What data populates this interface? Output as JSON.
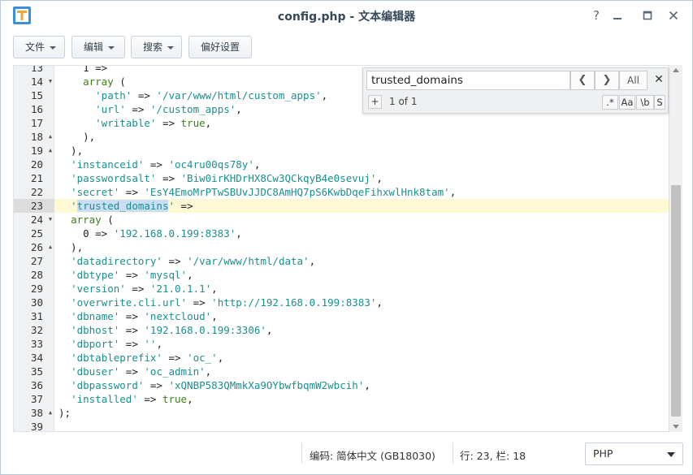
{
  "window": {
    "title": "config.php - 文本编辑器",
    "icons": {
      "help": "help-icon",
      "minimize": "minimize-icon",
      "maximize": "maximize-icon",
      "close": "close-icon"
    }
  },
  "toolbar": {
    "file": "文件",
    "edit": "编辑",
    "search": "搜索",
    "preferences": "偏好设置"
  },
  "search": {
    "query": "trusted_domains",
    "prev_glyph": "❮",
    "next_glyph": "❯",
    "all_label": "All",
    "close_glyph": "✕",
    "add_glyph": "+",
    "count": "1 of 1",
    "opt_regex": ".*",
    "opt_case": "Aa",
    "opt_word": "\\b",
    "opt_selection": "S"
  },
  "editor": {
    "active_line": 23,
    "lines": [
      {
        "n": "13",
        "fold": "",
        "code": "    1 =>"
      },
      {
        "n": "14",
        "fold": "▼",
        "code": "    array ("
      },
      {
        "n": "15",
        "fold": "",
        "code": "      'path' => '/var/www/html/custom_apps',"
      },
      {
        "n": "16",
        "fold": "",
        "code": "      'url' => '/custom_apps',"
      },
      {
        "n": "17",
        "fold": "",
        "code": "      'writable' => true,"
      },
      {
        "n": "18",
        "fold": "▲",
        "code": "    ),"
      },
      {
        "n": "19",
        "fold": "▲",
        "code": "  ),"
      },
      {
        "n": "20",
        "fold": "",
        "code": "  'instanceid' => 'oc4ru00qs78y',"
      },
      {
        "n": "21",
        "fold": "",
        "code": "  'passwordsalt' => 'Biw0irKHDrHX8Cw3QCkqyB4e0sevuj',"
      },
      {
        "n": "22",
        "fold": "",
        "code": "  'secret' => 'EsY4EmoMrPTwSBUvJJDC8AmHQ7pS6KwbDqeFihxwlHnk8tam',"
      },
      {
        "n": "23",
        "fold": "",
        "code": "  'trusted_domains' =>"
      },
      {
        "n": "24",
        "fold": "▼",
        "code": "  array ("
      },
      {
        "n": "25",
        "fold": "",
        "code": "    0 => '192.168.0.199:8383',"
      },
      {
        "n": "26",
        "fold": "▲",
        "code": "  ),"
      },
      {
        "n": "27",
        "fold": "",
        "code": "  'datadirectory' => '/var/www/html/data',"
      },
      {
        "n": "28",
        "fold": "",
        "code": "  'dbtype' => 'mysql',"
      },
      {
        "n": "29",
        "fold": "",
        "code": "  'version' => '21.0.1.1',"
      },
      {
        "n": "30",
        "fold": "",
        "code": "  'overwrite.cli.url' => 'http://192.168.0.199:8383',"
      },
      {
        "n": "31",
        "fold": "",
        "code": "  'dbname' => 'nextcloud',"
      },
      {
        "n": "32",
        "fold": "",
        "code": "  'dbhost' => '192.168.0.199:3306',"
      },
      {
        "n": "33",
        "fold": "",
        "code": "  'dbport' => '',"
      },
      {
        "n": "34",
        "fold": "",
        "code": "  'dbtableprefix' => 'oc_',"
      },
      {
        "n": "35",
        "fold": "",
        "code": "  'dbuser' => 'oc_admin',"
      },
      {
        "n": "36",
        "fold": "",
        "code": "  'dbpassword' => 'xQNBP583QMmkXa9OYbwfbqmW2wbcih',"
      },
      {
        "n": "37",
        "fold": "",
        "code": "  'installed' => true,"
      },
      {
        "n": "38",
        "fold": "▲",
        "code": ");"
      },
      {
        "n": "39",
        "fold": "",
        "code": ""
      }
    ]
  },
  "status": {
    "encoding": "编码: 简体中文 (GB18030)",
    "position": "行: 23, 栏: 18",
    "language": "PHP"
  },
  "colors": {
    "string": "#1a8f8f",
    "keyword": "#3a7f1a",
    "active_line": "#fff8d4",
    "match_highlight": "#c9def5"
  }
}
